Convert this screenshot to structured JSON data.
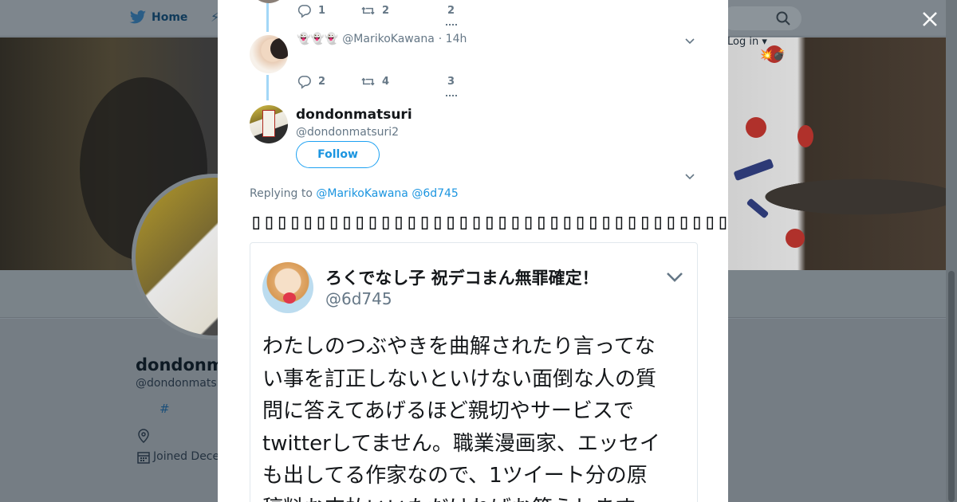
{
  "background": {
    "nav": {
      "home_label": "Home",
      "login_label": "Log in ▾"
    },
    "emoji": "💥💣",
    "profile": {
      "name": "dondonm",
      "handle": "@dondonmats",
      "hashtag": "#",
      "joined": "Joined Dece"
    }
  },
  "colors": {
    "accent": "#1da1f2",
    "link": "#1b95e0",
    "thread_line": "#a3d7f7",
    "muted": "#657786"
  },
  "thread": {
    "top_tweet": {
      "replies": "1",
      "retweets": "2",
      "likes": "2"
    },
    "reply_tweet": {
      "display_emoji": "👻👻👻",
      "handle": "@MarikoKawana",
      "time": "· 14h",
      "replies": "2",
      "retweets": "4",
      "likes": "3"
    }
  },
  "main_tweet": {
    "name": "dondonmatsuri",
    "handle": "@dondonmatsuri2",
    "follow_label": "Follow",
    "replying_prefix": "Replying to",
    "replying_to": [
      "@MarikoKawana",
      "@6d745"
    ],
    "text": "▯▯▯▯▯▯▯▯▯▯▯▯▯▯▯▯▯▯▯▯▯▯▯▯▯▯▯▯▯▯▯▯▯▯▯▯▯▯▯▯▯▯▯▯▯▯▯▯▯",
    "media": {
      "name": "ろくでなし子 祝デコまん無罪確定！",
      "handle": "@6d745",
      "lines": [
        "わたしのつぶやきを曲解されたり言ってな",
        "い事を訂正しないといけない面倒な人の質",
        "問に答えてあげるほど親切やサービスで",
        "twitterしてません。職業漫画家、エッセイ",
        "も出してる作家なので、1ツイート分の原",
        "稿料お支払いいただければお答えします"
      ]
    }
  }
}
